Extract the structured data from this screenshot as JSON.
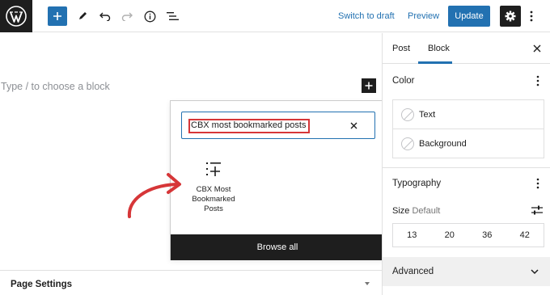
{
  "toolbar": {
    "switch_to_draft": "Switch to draft",
    "preview": "Preview",
    "update": "Update"
  },
  "canvas": {
    "placeholder": "Type / to choose a block"
  },
  "inserter": {
    "search_value": "CBX most bookmarked posts",
    "result_label_line1": "CBX Most",
    "result_label_line2": "Bookmarked",
    "result_label_line3": "Posts",
    "browse_all": "Browse all"
  },
  "page_settings": {
    "label": "Page Settings"
  },
  "sidebar": {
    "tabs": [
      "Post",
      "Block"
    ],
    "active_tab": "Block",
    "color": {
      "title": "Color",
      "items": [
        "Text",
        "Background"
      ]
    },
    "typography": {
      "title": "Typography",
      "size_label": "Size",
      "size_value": "Default",
      "sizes": [
        "13",
        "20",
        "36",
        "42"
      ]
    },
    "advanced": {
      "title": "Advanced"
    }
  },
  "colors": {
    "accent": "#2271b1",
    "dark": "#1e1e1e",
    "annotation": "#d63638"
  }
}
